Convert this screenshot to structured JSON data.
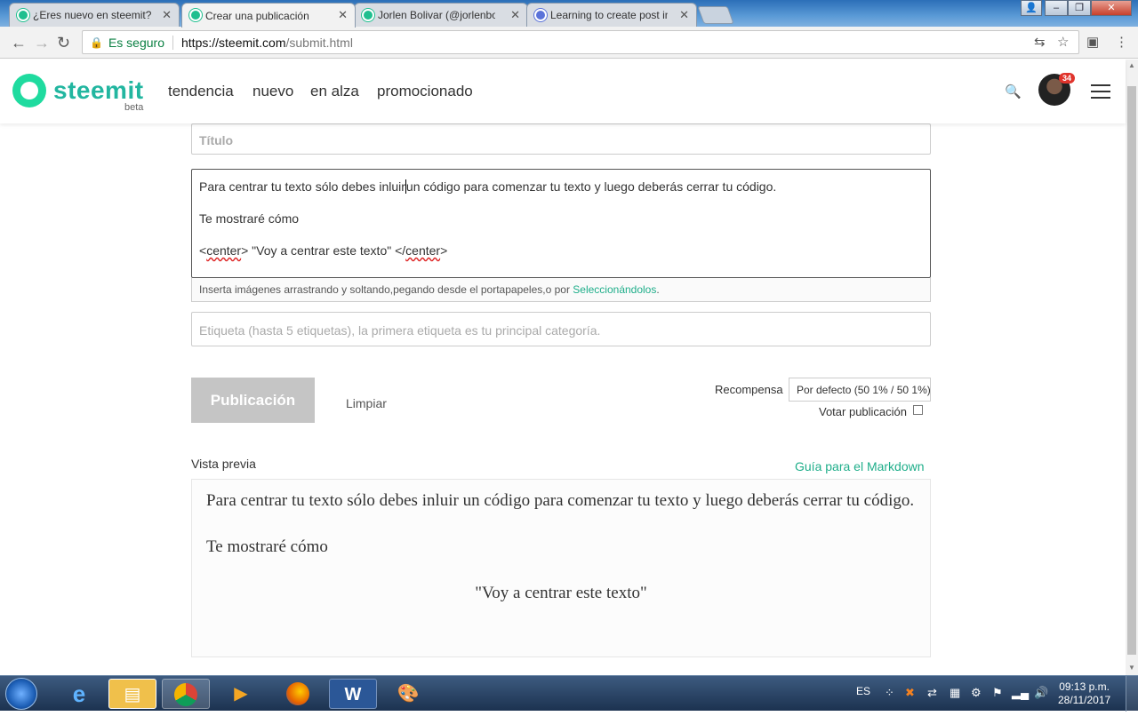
{
  "browser": {
    "tabs": [
      {
        "label": "¿Eres nuevo en steemit?"
      },
      {
        "label": "Crear una publicación — Steemit"
      },
      {
        "label": "Jorlen Bolivar (@jorlenbolivar)"
      },
      {
        "label": "Learning to create post in Steemit"
      }
    ],
    "address": {
      "secure_label": "Es seguro",
      "url_host": "https://steemit.com",
      "url_path": "/submit.html"
    }
  },
  "site": {
    "logo_text": "steemit",
    "logo_beta": "beta",
    "nav": [
      "tendencia",
      "nuevo",
      "en alza",
      "promocionado"
    ],
    "notification_count": "34"
  },
  "form": {
    "title_placeholder": "Título",
    "body_lines": {
      "line1_a": "Para centrar tu texto sólo debes inluir",
      "line1_b": "un código para comenzar tu texto y luego deberás cerrar tu código.",
      "line2": "Te mostraré cómo",
      "line3_open_a": "<",
      "line3_tag1": "center",
      "line3_mid": "> \"Voy a centrar este texto\" </",
      "line3_tag2": "center",
      "line3_close": ">"
    },
    "upload_hint": "Inserta imágenes arrastrando y soltando,pegando desde el portapapeles,o por ",
    "upload_link": "Seleccionándolos",
    "upload_end": ".",
    "tags_placeholder": "Etiqueta (hasta 5 etiquetas), la primera etiqueta es tu principal categoría.",
    "publish_label": "Publicación",
    "clear_label": "Limpiar",
    "reward_label": "Recompensa",
    "reward_value": "Por defecto (50 1% / 50 1%)",
    "vote_label": "Votar publicación",
    "vote_checked": false
  },
  "preview": {
    "label": "Vista previa",
    "guide_link": "Guía para el Markdown",
    "p1": "Para centrar tu texto sólo debes inluir un código para comenzar tu texto y luego deberás cerrar tu código.",
    "p2": "Te mostraré cómo",
    "p3": "\"Voy a centrar este texto\""
  },
  "taskbar": {
    "language": "ES",
    "time": "09:13 p.m.",
    "date": "28/11/2017",
    "apps": [
      "internet-explorer",
      "file-explorer",
      "chrome",
      "media-player",
      "firefox",
      "word",
      "paint"
    ]
  }
}
